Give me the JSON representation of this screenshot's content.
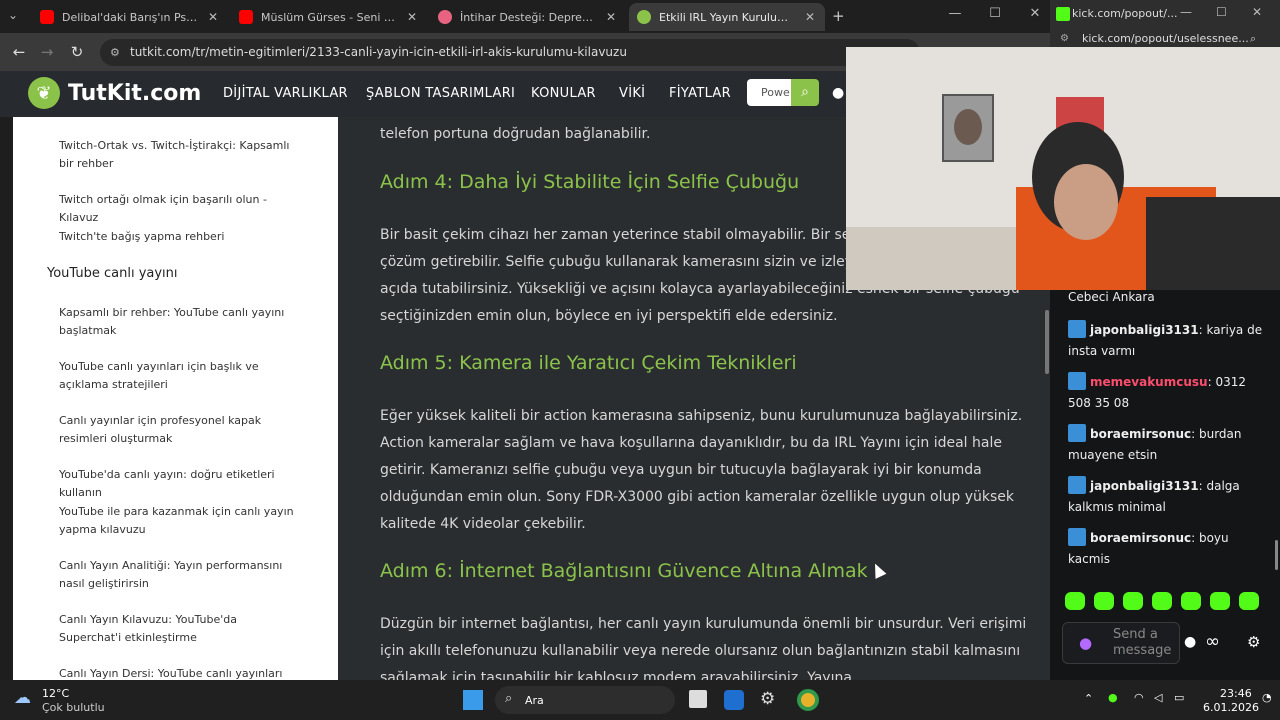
{
  "browser": {
    "tabs": [
      {
        "title": "Delibal'daki Barış'ın Psikolojisi |",
        "favicon_color": "#ff0000"
      },
      {
        "title": "Müslüm Gürses - Seni Yazdım -",
        "favicon_color": "#ff0000"
      },
      {
        "title": "İntihar Desteği: Depresyon Halin",
        "favicon_color": "#e8637f"
      },
      {
        "title": "Etkili IRL Yayın Kurulumu: Canlı",
        "favicon_color": "#8bc34a"
      }
    ],
    "url": "tutkit.com/tr/metin-egitimleri/2133-canli-yayin-icin-etkili-irl-akis-kurulumu-kilavuzu"
  },
  "site": {
    "logo": "TutKit.com",
    "nav": [
      "DİJİTAL VARLIKLAR",
      "ŞABLON TASARIMLARI",
      "KONULAR",
      "VİKİ",
      "FİYATLAR"
    ],
    "search_value": "Powe",
    "accent": "#8bc34a"
  },
  "sidebar": {
    "items_top": [
      "Twitch-Ortak vs. Twitch-İştirakçi: Kapsamlı bir rehber",
      "Twitch ortağı olmak için başarılı olun - Kılavuz",
      "Twitch'te bağış yapma rehberi"
    ],
    "section_title": "YouTube canlı yayını",
    "items": [
      "Kapsamlı bir rehber: YouTube canlı yayını başlatmak",
      "YouTube canlı yayınları için başlık ve açıklama stratejileri",
      "Canlı yayınlar için profesyonel kapak resimleri oluşturmak",
      "YouTube'da canlı yayın: doğru etiketleri kullanın",
      "YouTube ile para kazanmak için canlı yayın yapma kılavuzu",
      "Canlı Yayın Analitiği: Yayın performansını nasıl geliştirirsin",
      "Canlı Yayın Kılavuzu: YouTube'da Superchat'i etkinleştirme",
      "Canlı Yayın Dersi: YouTube canlı yayınları"
    ]
  },
  "article": {
    "p0": "telefon portuna doğrudan bağlanabilir.",
    "h4": "Adım 4: Daha İyi Stabilite İçin Selfie Çubuğu",
    "p4": "Bir basit çekim cihazı her zaman yeterince stabil olmayabilir. Bir selfie çubuğu burada çözüm getirebilir. Selfie çubuğu kullanarak kamerasını sizin ve izleyicileriniz için ideal bir açıda tutabilirsiniz. Yüksekliği ve açısını kolayca ayarlayabileceğiniz esnek bir selfie çubuğu seçtiğinizden emin olun, böylece en iyi perspektifi elde edersiniz.",
    "h5": "Adım 5: Kamera ile Yaratıcı Çekim Teknikleri",
    "p5": "Eğer yüksek kaliteli bir action kamerasına sahipseniz, bunu kurulumunuza bağlayabilirsiniz. Action kameralar sağlam ve hava koşullarına dayanıklıdır, bu da IRL Yayını için ideal hale getirir. Kameranızı selfie çubuğu veya uygun bir tutucuyla bağlayarak iyi bir konumda olduğundan emin olun. Sony FDR-X3000 gibi action kameralar özellikle uygun olup yüksek kalitede 4K videolar çekebilir.",
    "h6": "Adım 6: İnternet Bağlantısını Güvence Altına Almak",
    "p6": "Düzgün bir internet bağlantısı, her canlı yayın kurulumunda önemli bir unsurdur. Veri erişimi için akıllı telefonunuzu kullanabilir veya nerede olursanız olun bağlantınızın stabil kalmasını sağlamak için taşınabilir bir kablosuz modem arayabilirsiniz. Yayına"
  },
  "popout": {
    "title": "kick.com/popout/...",
    "url": "kick.com/popout/uselessnee..."
  },
  "chat": {
    "top_text": "Cebeci Ankara",
    "messages": [
      {
        "user": "japonbaligi3131",
        "text": "kariya de insta varmı",
        "color": "#eeeeee"
      },
      {
        "user": "memevakumcusu",
        "text": "0312 508 35 08",
        "color": "#ff4d6d"
      },
      {
        "user": "boraemirsonuc",
        "text": "burdan muayene etsin",
        "color": "#eeeeee"
      },
      {
        "user": "japonbaligi3131",
        "text": "dalga kalkmıs minimal",
        "color": "#eeeeee"
      },
      {
        "user": "boraemirsonuc",
        "text": "boyu kacmis",
        "color": "#eeeeee"
      }
    ],
    "input_placeholder": "Send a message"
  },
  "taskbar": {
    "temp": "12°C",
    "weather": "Çok bulutlu",
    "search": "Ara",
    "time": "23:46",
    "date": "6.01.2026"
  }
}
